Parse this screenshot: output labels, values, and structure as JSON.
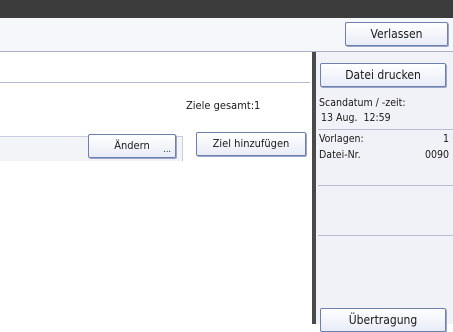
{
  "header": {
    "exit_label": "Verlassen"
  },
  "destinations": {
    "total_label": "Ziele gesamt:1",
    "change_label": "Ändern",
    "change_mark": "...",
    "add_label": "Ziel hinzufügen"
  },
  "file_info": {
    "print_label": "Datei drucken",
    "scan_datetime_label": "Scandatum / -zeit:",
    "scan_datetime_value": "13 Aug.  12:59",
    "originals_label": "Vorlagen:",
    "originals_value": "1",
    "file_no_label": "Datei-Nr.",
    "file_no_value": "0090",
    "transfer_label": "Übertragung"
  },
  "colors": {
    "accent_border": "#6f7fae",
    "panel_background": "#f1f2f7",
    "divider": "#4a4a4a"
  }
}
